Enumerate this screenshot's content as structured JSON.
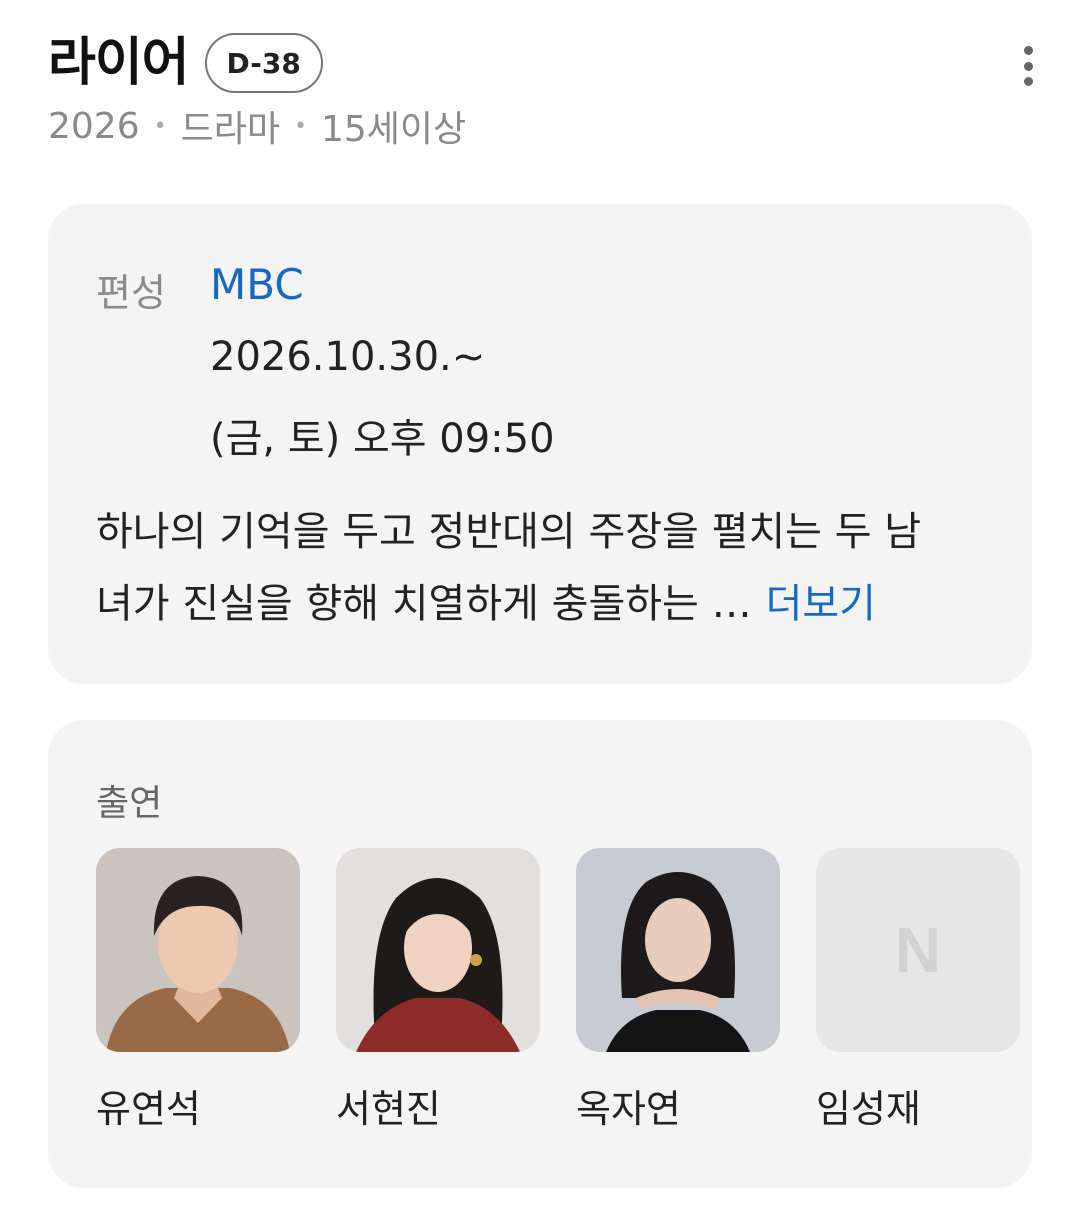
{
  "header": {
    "title": "라이어",
    "dday_badge": "D-38",
    "more_icon": "more-vertical-icon"
  },
  "meta": {
    "year": "2026",
    "genre": "드라마",
    "rating": "15세이상",
    "separator": "•"
  },
  "info": {
    "broadcast_label": "편성",
    "network": "MBC",
    "start_date": "2026.10.30.~",
    "schedule": "(금, 토) 오후 09:50",
    "synopsis_line1": "하나의 기억을 두고 정반대의 주장을 펼치는 두 남",
    "synopsis_line2": "녀가 진실을 향해 치열하게 충돌하는 …",
    "more_label": "더보기"
  },
  "cast": {
    "label": "출연",
    "members": [
      {
        "name": "유연석"
      },
      {
        "name": "서현진"
      },
      {
        "name": "옥자연"
      },
      {
        "name": "임성재",
        "placeholder_logo": "N"
      }
    ]
  },
  "colors": {
    "accent_link": "#1769c4",
    "card_bg": "#f4f4f4",
    "muted_text": "#8a8a8a"
  }
}
